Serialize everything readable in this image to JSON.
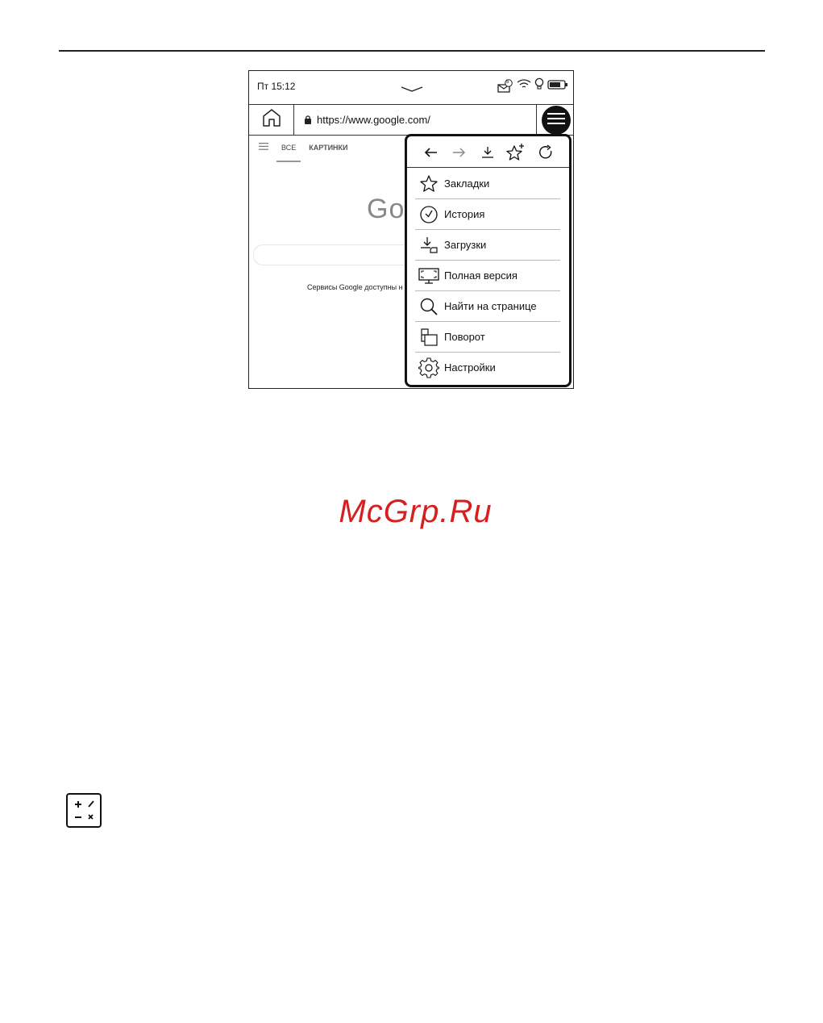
{
  "statusbar": {
    "time": "Пт 15:12",
    "notification_count": "5",
    "icons": [
      "chevron-down-icon",
      "mail-badge-icon",
      "wifi-icon",
      "bulb-icon",
      "battery-icon"
    ]
  },
  "urlbar": {
    "url": "https://www.google.com/",
    "icons": [
      "home-icon",
      "lock-icon",
      "hamburger-icon"
    ]
  },
  "google_page": {
    "tab_all": "ВСЕ",
    "tab_images": "КАРТИНКИ",
    "logo_partial": "Go",
    "services_text": "Сервисы Google доступны н"
  },
  "menu": {
    "toolbar_icons": [
      "back-arrow-icon",
      "forward-arrow-icon",
      "download-icon",
      "add-bookmark-icon",
      "reload-icon"
    ],
    "items": [
      {
        "label": "Закладки",
        "icon": "star-icon"
      },
      {
        "label": "История",
        "icon": "clock-icon"
      },
      {
        "label": "Загрузки",
        "icon": "download-folder-icon"
      },
      {
        "label": "Полная версия",
        "icon": "monitor-icon"
      },
      {
        "label": "Найти на странице",
        "icon": "search-icon"
      },
      {
        "label": "Поворот",
        "icon": "rotate-icon"
      },
      {
        "label": "Настройки",
        "icon": "gear-icon"
      }
    ]
  },
  "watermark": "McGrp.Ru",
  "colors": {
    "watermark": "#d62020",
    "ink": "#111111"
  }
}
